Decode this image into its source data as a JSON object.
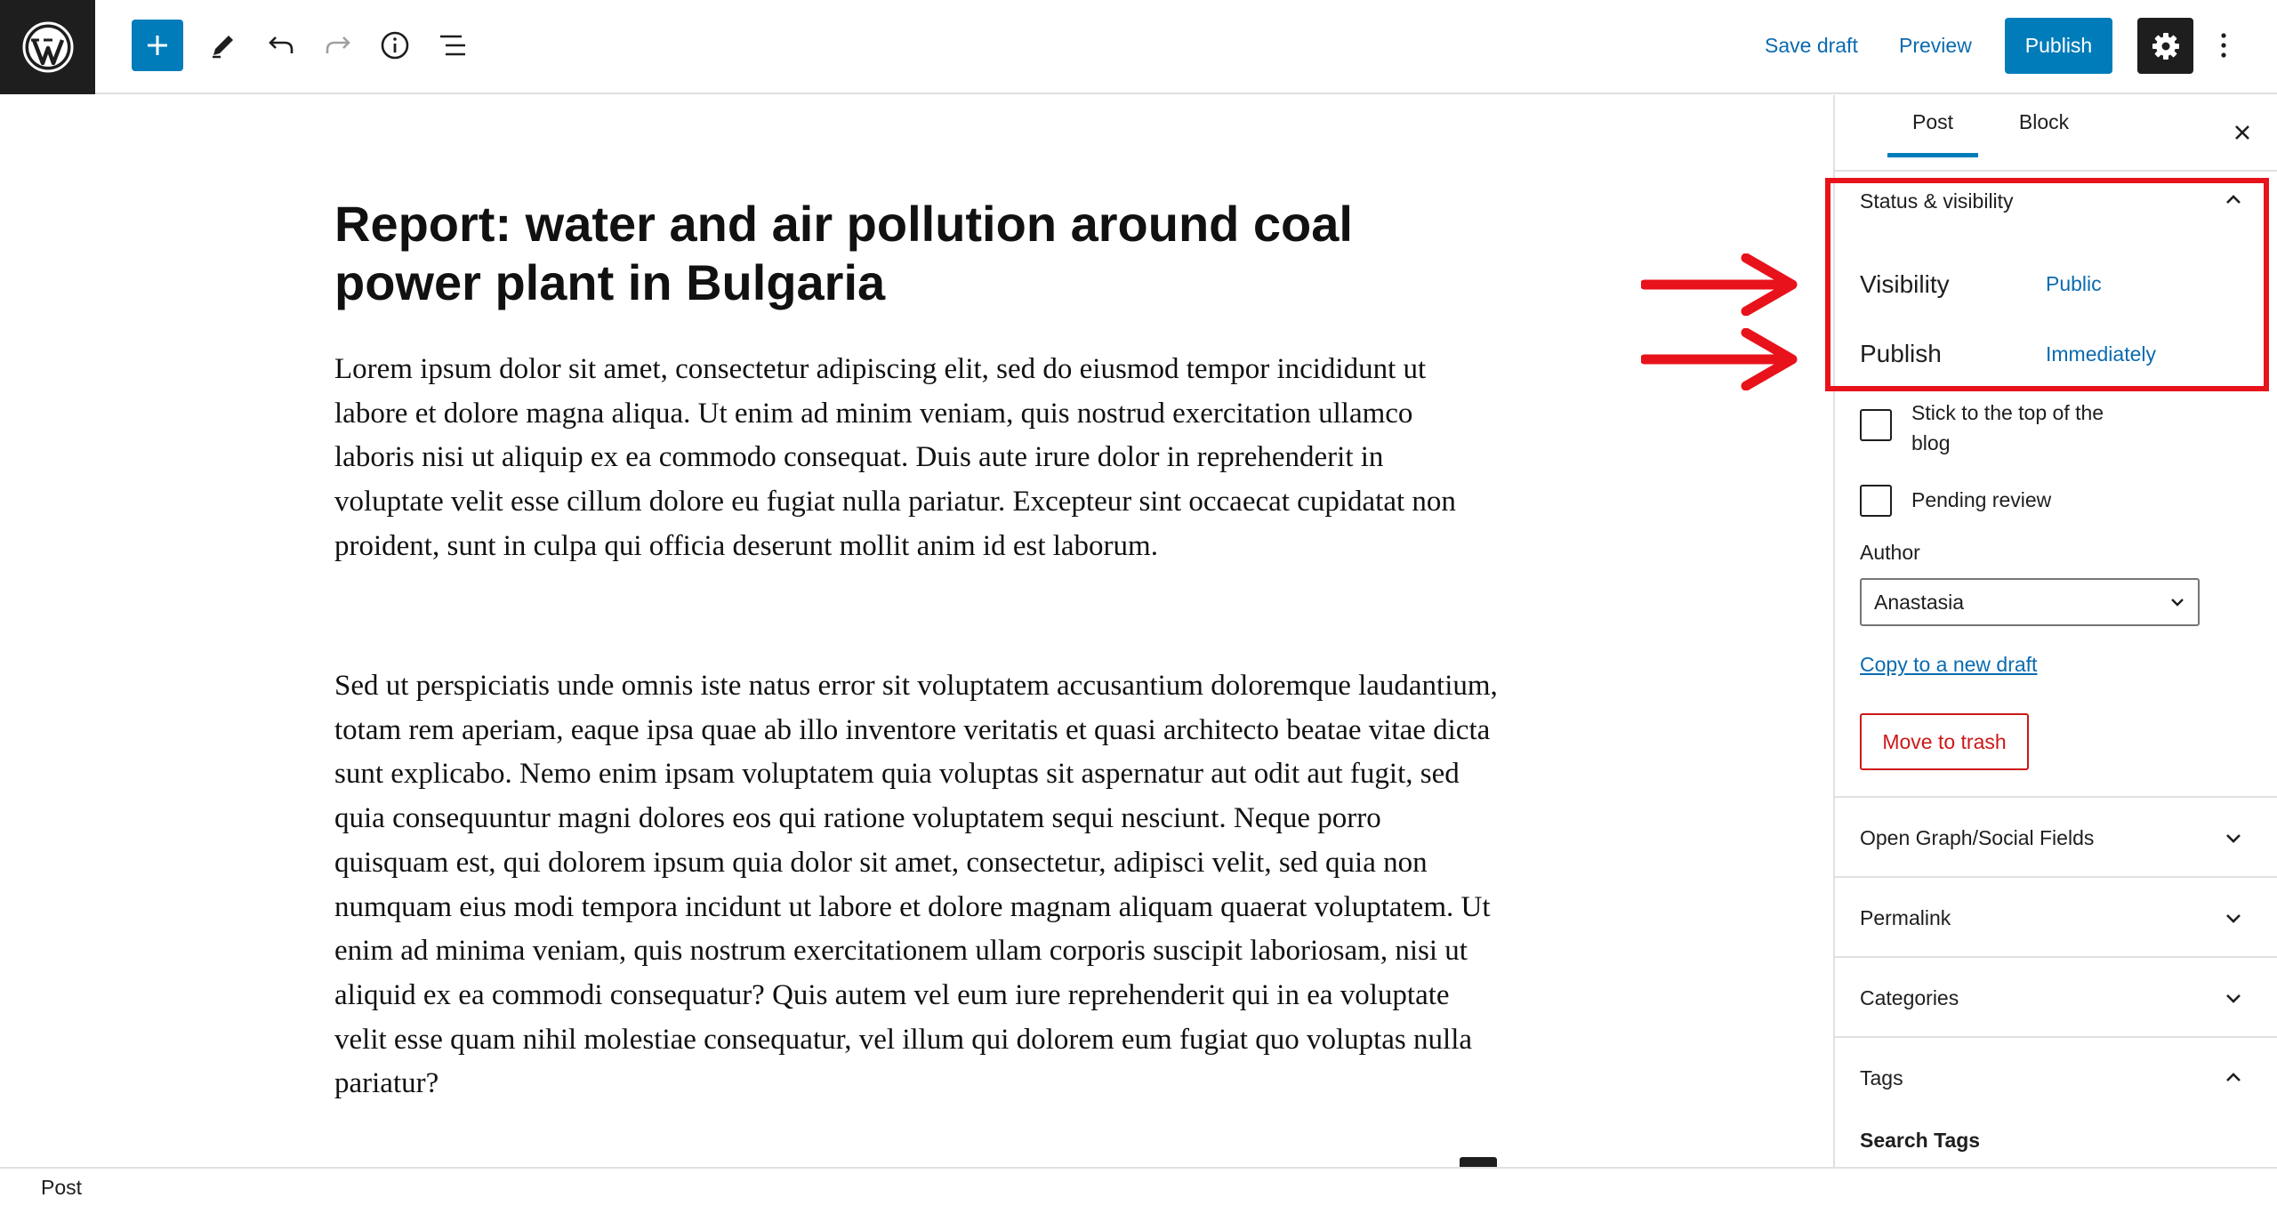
{
  "toolbar": {
    "logo_icon": "wordpress-logo",
    "inserter_icon": "plus-icon",
    "tools": [
      "pencil-icon",
      "undo-icon",
      "redo-icon",
      "info-icon",
      "list-view-icon"
    ],
    "save_draft_label": "Save draft",
    "preview_label": "Preview",
    "publish_label": "Publish",
    "settings_icon": "gear-icon",
    "more_icon": "vertical-ellipsis-icon"
  },
  "post": {
    "title": "Report: water and air pollution around coal power plant in Bulgaria",
    "paragraph1": "Lorem ipsum dolor sit amet, consectetur adipiscing elit, sed do eiusmod tempor incididunt ut labore et dolore magna aliqua. Ut enim ad minim veniam, quis nostrud exercitation ullamco laboris nisi ut aliquip ex ea commodo consequat. Duis aute irure dolor in reprehenderit in voluptate velit esse cillum dolore eu fugiat nulla pariatur. Excepteur sint occaecat cupidatat non proident, sunt in culpa qui officia deserunt mollit anim id est laborum.",
    "paragraph2": "Sed ut perspiciatis unde omnis iste natus error sit voluptatem accusantium doloremque laudantium, totam rem aperiam, eaque ipsa quae ab illo inventore veritatis et quasi architecto beatae vitae dicta sunt explicabo. Nemo enim ipsam voluptatem quia voluptas sit aspernatur aut odit aut fugit, sed quia consequuntur magni dolores eos qui ratione voluptatem sequi nesciunt. Neque porro quisquam est, qui dolorem ipsum quia dolor sit amet, consectetur, adipisci velit, sed quia non numquam eius modi tempora incidunt ut labore et dolore magnam aliquam quaerat voluptatem. Ut enim ad minima veniam, quis nostrum exercitationem ullam corporis suscipit laboriosam, nisi ut aliquid ex ea commodi consequatur? Quis autem vel eum iure reprehenderit qui in ea voluptate velit esse quam nihil molestiae consequatur, vel illum qui dolorem eum fugiat quo voluptas nulla pariatur?"
  },
  "sidebar": {
    "tabs": [
      {
        "label": "Post",
        "active": true
      },
      {
        "label": "Block",
        "active": false
      }
    ],
    "close_icon": "close-icon",
    "status_panel": {
      "title": "Status & visibility",
      "expanded": true,
      "visibility_label": "Visibility",
      "visibility_value": "Public",
      "publish_label": "Publish",
      "publish_value": "Immediately",
      "sticky_label": "Stick to the top of the blog",
      "sticky_checked": false,
      "pending_label": "Pending review",
      "pending_checked": false,
      "author_label": "Author",
      "author_value": "Anastasia",
      "copy_draft_label": "Copy to a new draft",
      "trash_label": "Move to trash"
    },
    "panels": [
      {
        "title": "Open Graph/Social Fields",
        "expanded": false
      },
      {
        "title": "Permalink",
        "expanded": false
      },
      {
        "title": "Categories",
        "expanded": false
      },
      {
        "title": "Tags",
        "expanded": true
      }
    ],
    "tags_search_label": "Search Tags"
  },
  "footer": {
    "breadcrumb": "Post"
  },
  "colors": {
    "accent": "#007cba",
    "link": "#0a6bb0",
    "dark": "#1e1e1e",
    "danger": "#cc1818",
    "annotation": "#e8121b"
  }
}
